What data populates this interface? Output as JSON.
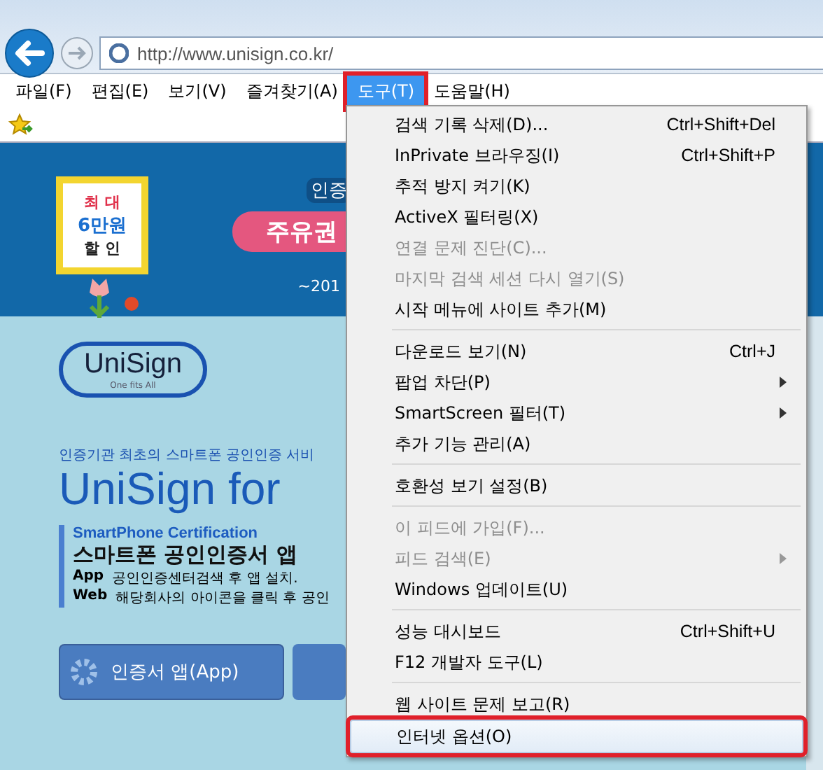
{
  "address_bar": {
    "url": "http://www.unisign.co.kr/"
  },
  "menu_bar": [
    {
      "label": "파일(F)",
      "selected": false,
      "outlined": false
    },
    {
      "label": "편집(E)",
      "selected": false,
      "outlined": false
    },
    {
      "label": "보기(V)",
      "selected": false,
      "outlined": false
    },
    {
      "label": "즐겨찾기(A)",
      "selected": false,
      "outlined": false
    },
    {
      "label": "도구(T)",
      "selected": true,
      "outlined": true
    },
    {
      "label": "도움말(H)",
      "selected": false,
      "outlined": false
    }
  ],
  "tools_menu": [
    {
      "kind": "item",
      "label": "검색 기록 삭제(D)...",
      "shortcut": "Ctrl+Shift+Del",
      "disabled": false,
      "submenu": false,
      "selected": false,
      "outlined": false
    },
    {
      "kind": "item",
      "label": "InPrivate 브라우징(I)",
      "shortcut": "Ctrl+Shift+P",
      "disabled": false,
      "submenu": false,
      "selected": false,
      "outlined": false
    },
    {
      "kind": "item",
      "label": "추적 방지 켜기(K)",
      "disabled": false,
      "submenu": false,
      "selected": false,
      "outlined": false
    },
    {
      "kind": "item",
      "label": "ActiveX 필터링(X)",
      "disabled": false,
      "submenu": false,
      "selected": false,
      "outlined": false
    },
    {
      "kind": "item",
      "label": "연결 문제 진단(C)...",
      "disabled": true,
      "submenu": false,
      "selected": false,
      "outlined": false
    },
    {
      "kind": "item",
      "label": "마지막 검색 세션 다시 열기(S)",
      "disabled": true,
      "submenu": false,
      "selected": false,
      "outlined": false
    },
    {
      "kind": "item",
      "label": "시작 메뉴에 사이트 추가(M)",
      "disabled": false,
      "submenu": false,
      "selected": false,
      "outlined": false
    },
    {
      "kind": "separator"
    },
    {
      "kind": "item",
      "label": "다운로드 보기(N)",
      "shortcut": "Ctrl+J",
      "disabled": false,
      "submenu": false,
      "selected": false,
      "outlined": false
    },
    {
      "kind": "item",
      "label": "팝업 차단(P)",
      "disabled": false,
      "submenu": true,
      "selected": false,
      "outlined": false
    },
    {
      "kind": "item",
      "label": "SmartScreen 필터(T)",
      "disabled": false,
      "submenu": true,
      "selected": false,
      "outlined": false
    },
    {
      "kind": "item",
      "label": "추가 기능 관리(A)",
      "disabled": false,
      "submenu": false,
      "selected": false,
      "outlined": false
    },
    {
      "kind": "separator"
    },
    {
      "kind": "item",
      "label": "호환성 보기 설정(B)",
      "disabled": false,
      "submenu": false,
      "selected": false,
      "outlined": false
    },
    {
      "kind": "separator"
    },
    {
      "kind": "item",
      "label": "이 피드에 가입(F)...",
      "disabled": true,
      "submenu": false,
      "selected": false,
      "outlined": false
    },
    {
      "kind": "item",
      "label": "피드 검색(E)",
      "disabled": true,
      "submenu": true,
      "selected": false,
      "outlined": false
    },
    {
      "kind": "item",
      "label": "Windows 업데이트(U)",
      "disabled": false,
      "submenu": false,
      "selected": false,
      "outlined": false
    },
    {
      "kind": "separator"
    },
    {
      "kind": "item",
      "label": "성능 대시보드",
      "shortcut": "Ctrl+Shift+U",
      "disabled": false,
      "submenu": false,
      "selected": false,
      "outlined": false
    },
    {
      "kind": "item",
      "label": "F12 개발자 도구(L)",
      "disabled": false,
      "submenu": false,
      "selected": false,
      "outlined": false
    },
    {
      "kind": "separator"
    },
    {
      "kind": "item",
      "label": "웹 사이트 문제 보고(R)",
      "disabled": false,
      "submenu": false,
      "selected": false,
      "outlined": false
    },
    {
      "kind": "item",
      "label": "인터넷 옵션(O)",
      "disabled": false,
      "submenu": false,
      "selected": true,
      "outlined": true
    }
  ],
  "page": {
    "banner": {
      "badge": [
        "최 대",
        "6만원",
        "할 인"
      ],
      "chip": "인증",
      "pill": "주유권",
      "date": "~201"
    },
    "logo": {
      "name": "UniSign",
      "tagline": "One fits All"
    },
    "intro": "인증기관 최초의 스마트폰 공인인증 서비",
    "headline": "UniSign for",
    "subtitle": "SmartPhone Certification",
    "title": "스마트폰 공인인증서 앱",
    "steps": [
      {
        "label": "App",
        "text": "공인인증센터검색  후 앱 설치."
      },
      {
        "label": "Web",
        "text": "해당회사의 아이콘을 클릭 후 공인"
      }
    ],
    "button": "인증서 앱(App)"
  }
}
